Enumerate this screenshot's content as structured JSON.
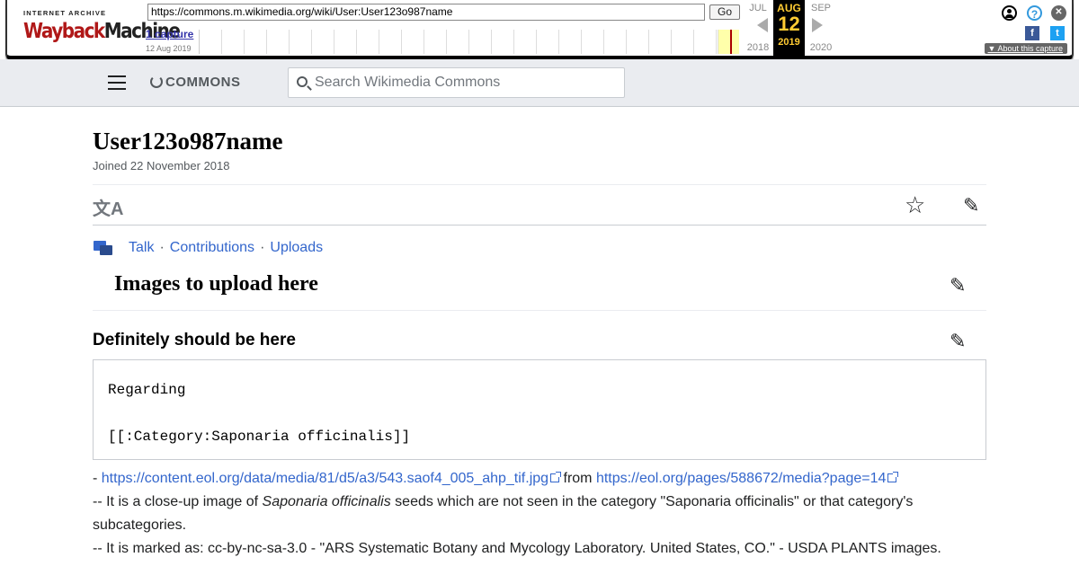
{
  "wayback": {
    "logo_top": "INTERNET ARCHIVE",
    "logo_main_a": "Wayback",
    "logo_main_b": "Machine",
    "url": "https://commons.m.wikimedia.org/wiki/User:User123o987name",
    "go_label": "Go",
    "captures_label": "1 capture",
    "capture_date": "12 Aug 2019",
    "prev_month": "JUL",
    "prev_year": "2018",
    "cur_month": "AUG",
    "cur_day": "12",
    "cur_year": "2019",
    "next_month": "SEP",
    "next_year": "2020",
    "about_label": "About this capture",
    "help_glyph": "?",
    "close_glyph": "✕",
    "fb_glyph": "f",
    "tw_glyph": "t"
  },
  "header": {
    "brand": "COMMONS",
    "search_placeholder": "Search Wikimedia Commons"
  },
  "page": {
    "title": "User123o987name",
    "joined": "Joined 22 November 2018",
    "lang_glyph": "文A",
    "star_glyph": "☆",
    "edit_glyph": "✎",
    "nav": {
      "talk": "Talk",
      "contributions": "Contributions",
      "uploads": "Uploads",
      "sep": "·"
    },
    "section_heading": "Images to upload here",
    "subsection_heading": "Definitely should be here",
    "pre_line1": "Regarding",
    "pre_line2": "[[:Category:Saponaria officinalis]]",
    "body": {
      "dash": "- ",
      "link1": "https://content.eol.org/data/media/81/d5/a3/543.saof4_005_ahp_tif.jpg",
      "from": " from ",
      "link2": "https://eol.org/pages/588672/media?page=14",
      "line2_a": "-- It is a close-up image of ",
      "line2_italic": "Saponaria officinalis",
      "line2_b": " seeds which are not seen in the category \"Saponaria officinalis\" or that category's subcategories.",
      "line3": "-- It is marked as: cc-by-nc-sa-3.0 - \"ARS Systematic Botany and Mycology Laboratory. United States, CO.\" - USDA PLANTS images."
    }
  }
}
